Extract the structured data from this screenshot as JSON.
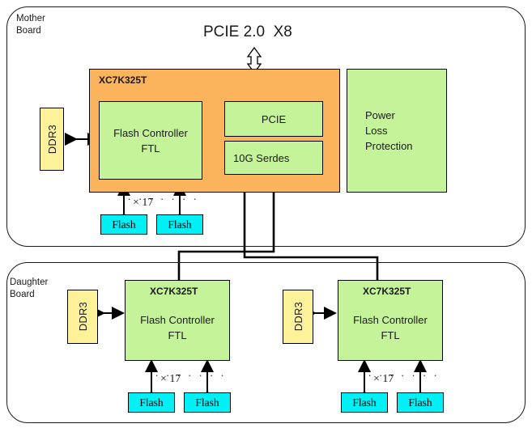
{
  "diagram": {
    "title_caption": "PCIE 2.0  X8",
    "boards": [
      {
        "name": "mother",
        "label": "Mother\nBoard"
      },
      {
        "name": "daughter",
        "label": "Daughter\nBoard"
      }
    ],
    "mother": {
      "fpga_label": "XC7K325T",
      "ddr3_label": "DDR3",
      "flash_controller_label": "Flash Controller\nFTL",
      "pcie_label": "PCIE",
      "serdes_label": "10G Serdes",
      "power_loss_label": "Power\nLoss\nProtection",
      "flash_left_label": "Flash",
      "flash_right_label": "Flash",
      "multiplier_label": "× 17",
      "dots_label": ". . . . . . ."
    },
    "daughter_left": {
      "fpga_label": "XC7K325T",
      "ddr3_label": "DDR3",
      "flash_controller_label": "Flash Controller\nFTL",
      "flash_left_label": "Flash",
      "flash_right_label": "Flash",
      "multiplier_label": "× 17",
      "dots_label": ". . . . . . ."
    },
    "daughter_right": {
      "fpga_label": "XC7K325T",
      "ddr3_label": "DDR3",
      "flash_controller_label": "Flash Controller\nFTL",
      "flash_left_label": "Flash",
      "flash_right_label": "Flash",
      "multiplier_label": "× 17",
      "dots_label": ". . . . . . ."
    },
    "colors": {
      "fpga_fill": "#fbb45c",
      "block_fill": "#c5f39a",
      "memory_fill": "#fdf29a",
      "flash_fill": "#00f0f5",
      "outline": "#000000",
      "board_outline": "#1a1a1a",
      "text": "#1a1a1a"
    }
  }
}
